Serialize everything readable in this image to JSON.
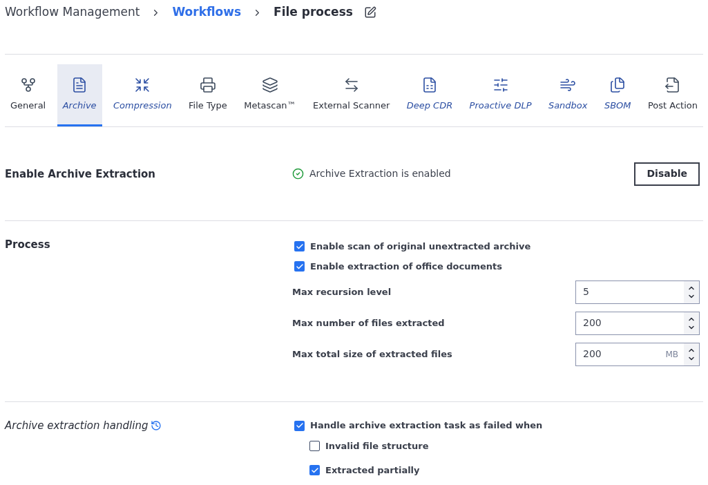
{
  "breadcrumb": [
    {
      "label": "Workflow Management",
      "kind": "plain"
    },
    {
      "label": "Workflows",
      "kind": "link"
    },
    {
      "label": "File process",
      "kind": "current"
    }
  ],
  "tabs": [
    {
      "label": "General",
      "selected": false,
      "modified": false
    },
    {
      "label": "Archive",
      "selected": true,
      "modified": true
    },
    {
      "label": "Compression",
      "selected": false,
      "modified": true
    },
    {
      "label": "File Type",
      "selected": false,
      "modified": false
    },
    {
      "label": "Metascan™",
      "selected": false,
      "modified": false
    },
    {
      "label": "External Scanner",
      "selected": false,
      "modified": false
    },
    {
      "label": "Deep CDR",
      "selected": false,
      "modified": true
    },
    {
      "label": "Proactive DLP",
      "selected": false,
      "modified": true
    },
    {
      "label": "Sandbox",
      "selected": false,
      "modified": true
    },
    {
      "label": "SBOM",
      "selected": false,
      "modified": true
    },
    {
      "label": "Post Action",
      "selected": false,
      "modified": false
    }
  ],
  "enable_section": {
    "title": "Enable Archive Extraction",
    "status": "Archive Extraction is enabled",
    "enabled": true,
    "button": "Disable"
  },
  "process_section": {
    "title": "Process",
    "checkboxes": [
      {
        "label": "Enable scan of original unextracted archive",
        "checked": true
      },
      {
        "label": "Enable extraction of office documents",
        "checked": true
      }
    ],
    "fields": [
      {
        "label": "Max recursion level",
        "value": "5"
      },
      {
        "label": "Max number of files extracted",
        "value": "200"
      },
      {
        "label": "Max total size of extracted files",
        "value": "200",
        "unit": "MB"
      }
    ]
  },
  "handling_section": {
    "title": "Archive extraction handling",
    "modified": true,
    "checkbox": {
      "label": "Handle archive extraction task as failed when",
      "checked": true
    },
    "children": [
      {
        "label": "Invalid file structure",
        "checked": false
      },
      {
        "label": "Extracted partially",
        "checked": true
      }
    ]
  }
}
